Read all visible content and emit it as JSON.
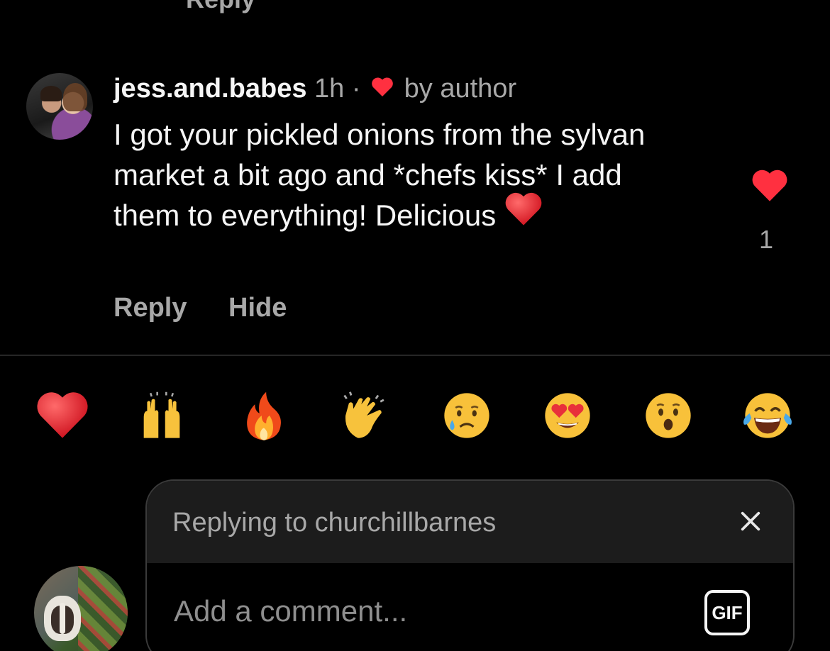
{
  "top_partial": {
    "reply_label": "Reply"
  },
  "comment": {
    "username": "jess.and.babes",
    "time": "1h",
    "separator": "·",
    "liked_by": "by author",
    "text": "I got your pickled onions from the sylvan market a bit ago and *chefs kiss* I add them to everything! Delicious",
    "like_count": "1",
    "actions": {
      "reply": "Reply",
      "hide": "Hide"
    }
  },
  "reactions": [
    "red-heart",
    "raising-hands",
    "fire",
    "clapping-hands",
    "crying-face",
    "heart-eyes-face",
    "surprised-face",
    "tears-of-joy-face"
  ],
  "composer": {
    "replying_to": "Replying to churchillbarnes",
    "placeholder": "Add a comment...",
    "gif_label": "GIF"
  },
  "colors": {
    "background": "#000000",
    "primary_text": "#f5f5f5",
    "secondary_text": "#a8a8a8",
    "heart_red": "#ff3040",
    "divider": "#262626",
    "composer_header": "#1c1c1c"
  }
}
